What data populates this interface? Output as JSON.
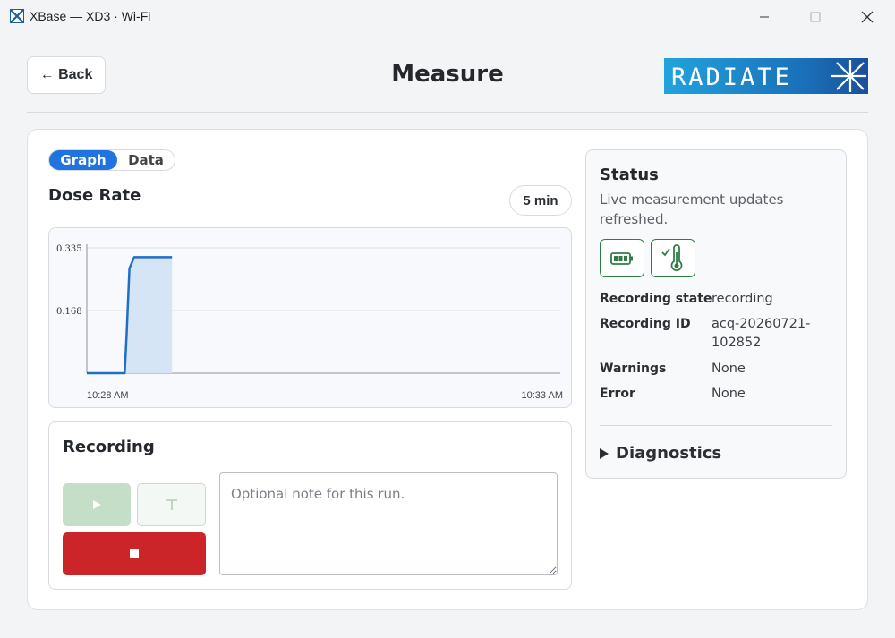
{
  "window": {
    "title": "XBase — XD3 · Wi-Fi"
  },
  "header": {
    "back_label": "← Back",
    "title": "Measure",
    "logo_text": "RADIATE"
  },
  "tabs": [
    {
      "label": "Graph",
      "active": true
    },
    {
      "label": "Data",
      "active": false
    }
  ],
  "chart_panel": {
    "title": "Dose Rate",
    "range_label": "5 min"
  },
  "chart_data": {
    "type": "area",
    "title": "",
    "xlabel": "",
    "ylabel": "",
    "x_tick_labels": [
      "10:28 AM",
      "10:33 AM"
    ],
    "x_range_minutes": [
      0,
      5
    ],
    "y_tick_labels": [
      "0.335",
      "0.168"
    ],
    "y_ticks": [
      0.335,
      0.168
    ],
    "ylim": [
      0,
      0.335
    ],
    "grid": true,
    "color": "#1f6fc5",
    "fill": "#d6e5f6",
    "series": [
      {
        "x": [
          0,
          0.35,
          0.4,
          0.42,
          0.45,
          0.5,
          0.7,
          0.9
        ],
        "values": [
          0,
          0,
          0,
          0.1,
          0.28,
          0.31,
          0.31,
          0.31
        ]
      }
    ]
  },
  "recording": {
    "title": "Recording",
    "note_placeholder": "Optional note for this run."
  },
  "status": {
    "title": "Status",
    "message": "Live measurement updates refreshed.",
    "rows": [
      {
        "label": "Recording state",
        "value": "recording"
      },
      {
        "label": "Recording ID",
        "value": "acq-20260721-102852"
      },
      {
        "label": "Warnings",
        "value": "None"
      },
      {
        "label": "Error",
        "value": "None"
      }
    ],
    "diagnostics_label": "Diagnostics",
    "indicator_color": "#2e7d46"
  }
}
